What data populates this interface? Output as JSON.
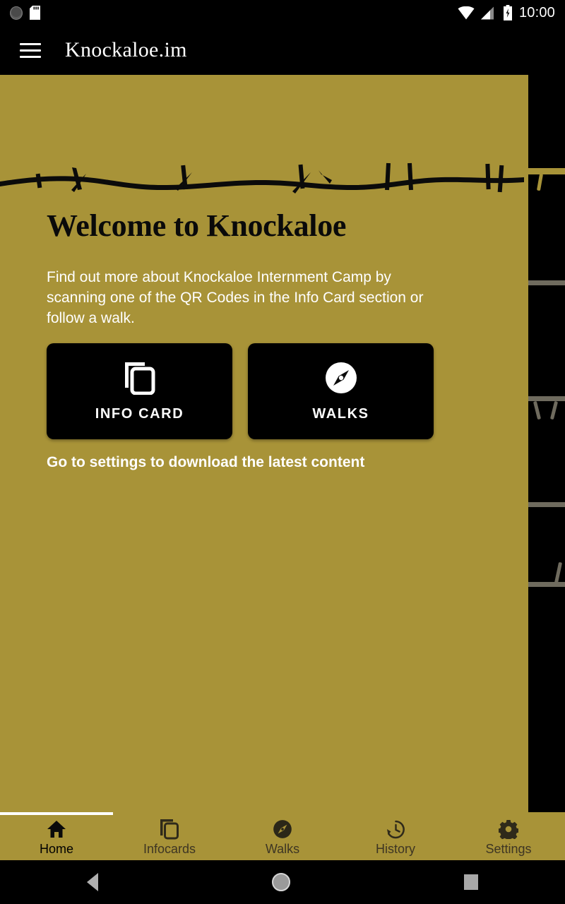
{
  "status_bar": {
    "time": "10:00",
    "icons_left": [
      "circle-status-icon",
      "sd-card-icon"
    ],
    "icons_right": [
      "wifi-icon",
      "signal-icon",
      "battery-charging-icon"
    ]
  },
  "app_bar": {
    "menu_icon": "hamburger-menu-icon",
    "title": "Knockaloe.im"
  },
  "main": {
    "heading": "Welcome to Knockaloe",
    "body": "Find out more about Knockaloe Internment Camp by scanning one of the QR Codes in the Info Card section or follow a walk.",
    "note": "Go to settings to download the latest content",
    "buttons": [
      {
        "label": "INFO CARD",
        "icon": "copy-cards-icon"
      },
      {
        "label": "WALKS",
        "icon": "compass-icon"
      }
    ]
  },
  "bottom_nav": {
    "active_index": 0,
    "items": [
      {
        "label": "Home",
        "icon": "home-icon"
      },
      {
        "label": "Infocards",
        "icon": "copy-cards-icon"
      },
      {
        "label": "Walks",
        "icon": "compass-icon"
      },
      {
        "label": "History",
        "icon": "history-clock-icon"
      },
      {
        "label": "Settings",
        "icon": "gear-icon"
      }
    ]
  },
  "system_nav": {
    "back": "back-triangle-icon",
    "home": "home-circle-icon",
    "recents": "recents-square-icon"
  },
  "colors": {
    "gold": "#a89338",
    "black": "#000000",
    "white": "#ffffff",
    "nav_inactive": "#3d3523",
    "panel_wire": "#6f6b5e"
  }
}
